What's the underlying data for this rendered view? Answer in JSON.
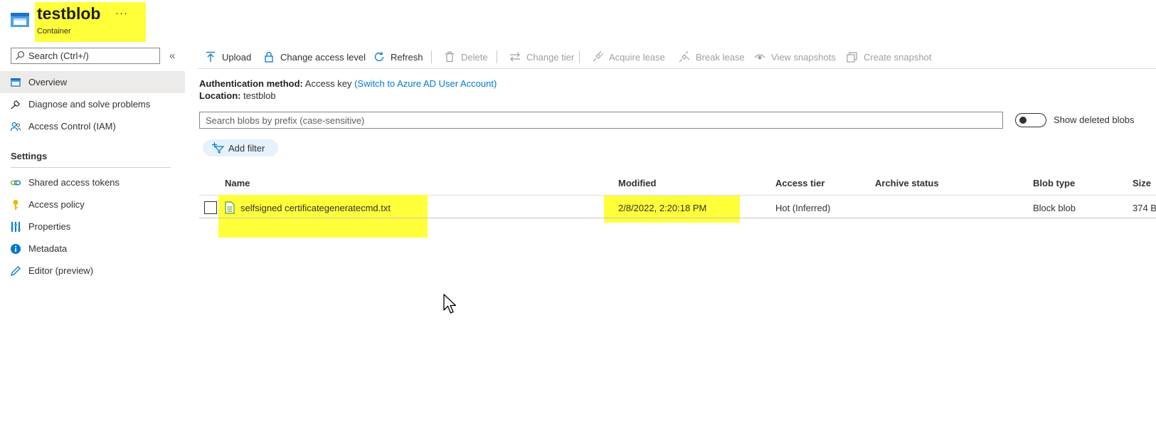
{
  "header": {
    "title": "testblob",
    "more": "···",
    "subtitle": "Container"
  },
  "sidebar": {
    "search_placeholder": "Search (Ctrl+/)",
    "collapse": "«",
    "items": [
      {
        "label": "Overview",
        "icon": "container-icon",
        "active": true
      },
      {
        "label": "Diagnose and solve problems",
        "icon": "wrench-icon"
      },
      {
        "label": "Access Control (IAM)",
        "icon": "people-icon"
      }
    ],
    "section_title": "Settings",
    "settings_items": [
      {
        "label": "Shared access tokens",
        "icon": "link-icon"
      },
      {
        "label": "Access policy",
        "icon": "key-icon"
      },
      {
        "label": "Properties",
        "icon": "properties-icon"
      },
      {
        "label": "Metadata",
        "icon": "info-icon"
      },
      {
        "label": "Editor (preview)",
        "icon": "pencil-icon"
      }
    ]
  },
  "toolbar": {
    "upload": "Upload",
    "change_access_level": "Change access level",
    "refresh": "Refresh",
    "delete": "Delete",
    "change_tier": "Change tier",
    "acquire_lease": "Acquire lease",
    "break_lease": "Break lease",
    "view_snapshots": "View snapshots",
    "create_snapshot": "Create snapshot"
  },
  "info": {
    "auth_label": "Authentication method:",
    "auth_value": "Access key",
    "auth_link": "(Switch to Azure AD User Account)",
    "location_label": "Location:",
    "location_value": "testblob"
  },
  "filter": {
    "prefix_placeholder": "Search blobs by prefix (case-sensitive)",
    "show_deleted_label": "Show deleted blobs",
    "show_deleted_on": false,
    "add_filter": "Add filter"
  },
  "table": {
    "columns": [
      "Name",
      "Modified",
      "Access tier",
      "Archive status",
      "Blob type",
      "Size"
    ],
    "rows": [
      {
        "name": "selfsigned certificategeneratecmd.txt",
        "modified": "2/8/2022, 2:20:18 PM",
        "access_tier": "Hot (Inferred)",
        "archive_status": "",
        "blob_type": "Block blob",
        "size": "374 B"
      }
    ]
  },
  "colors": {
    "highlight": "#ffff3a",
    "accent": "#0078d4",
    "active_nav": "#edebe9"
  }
}
